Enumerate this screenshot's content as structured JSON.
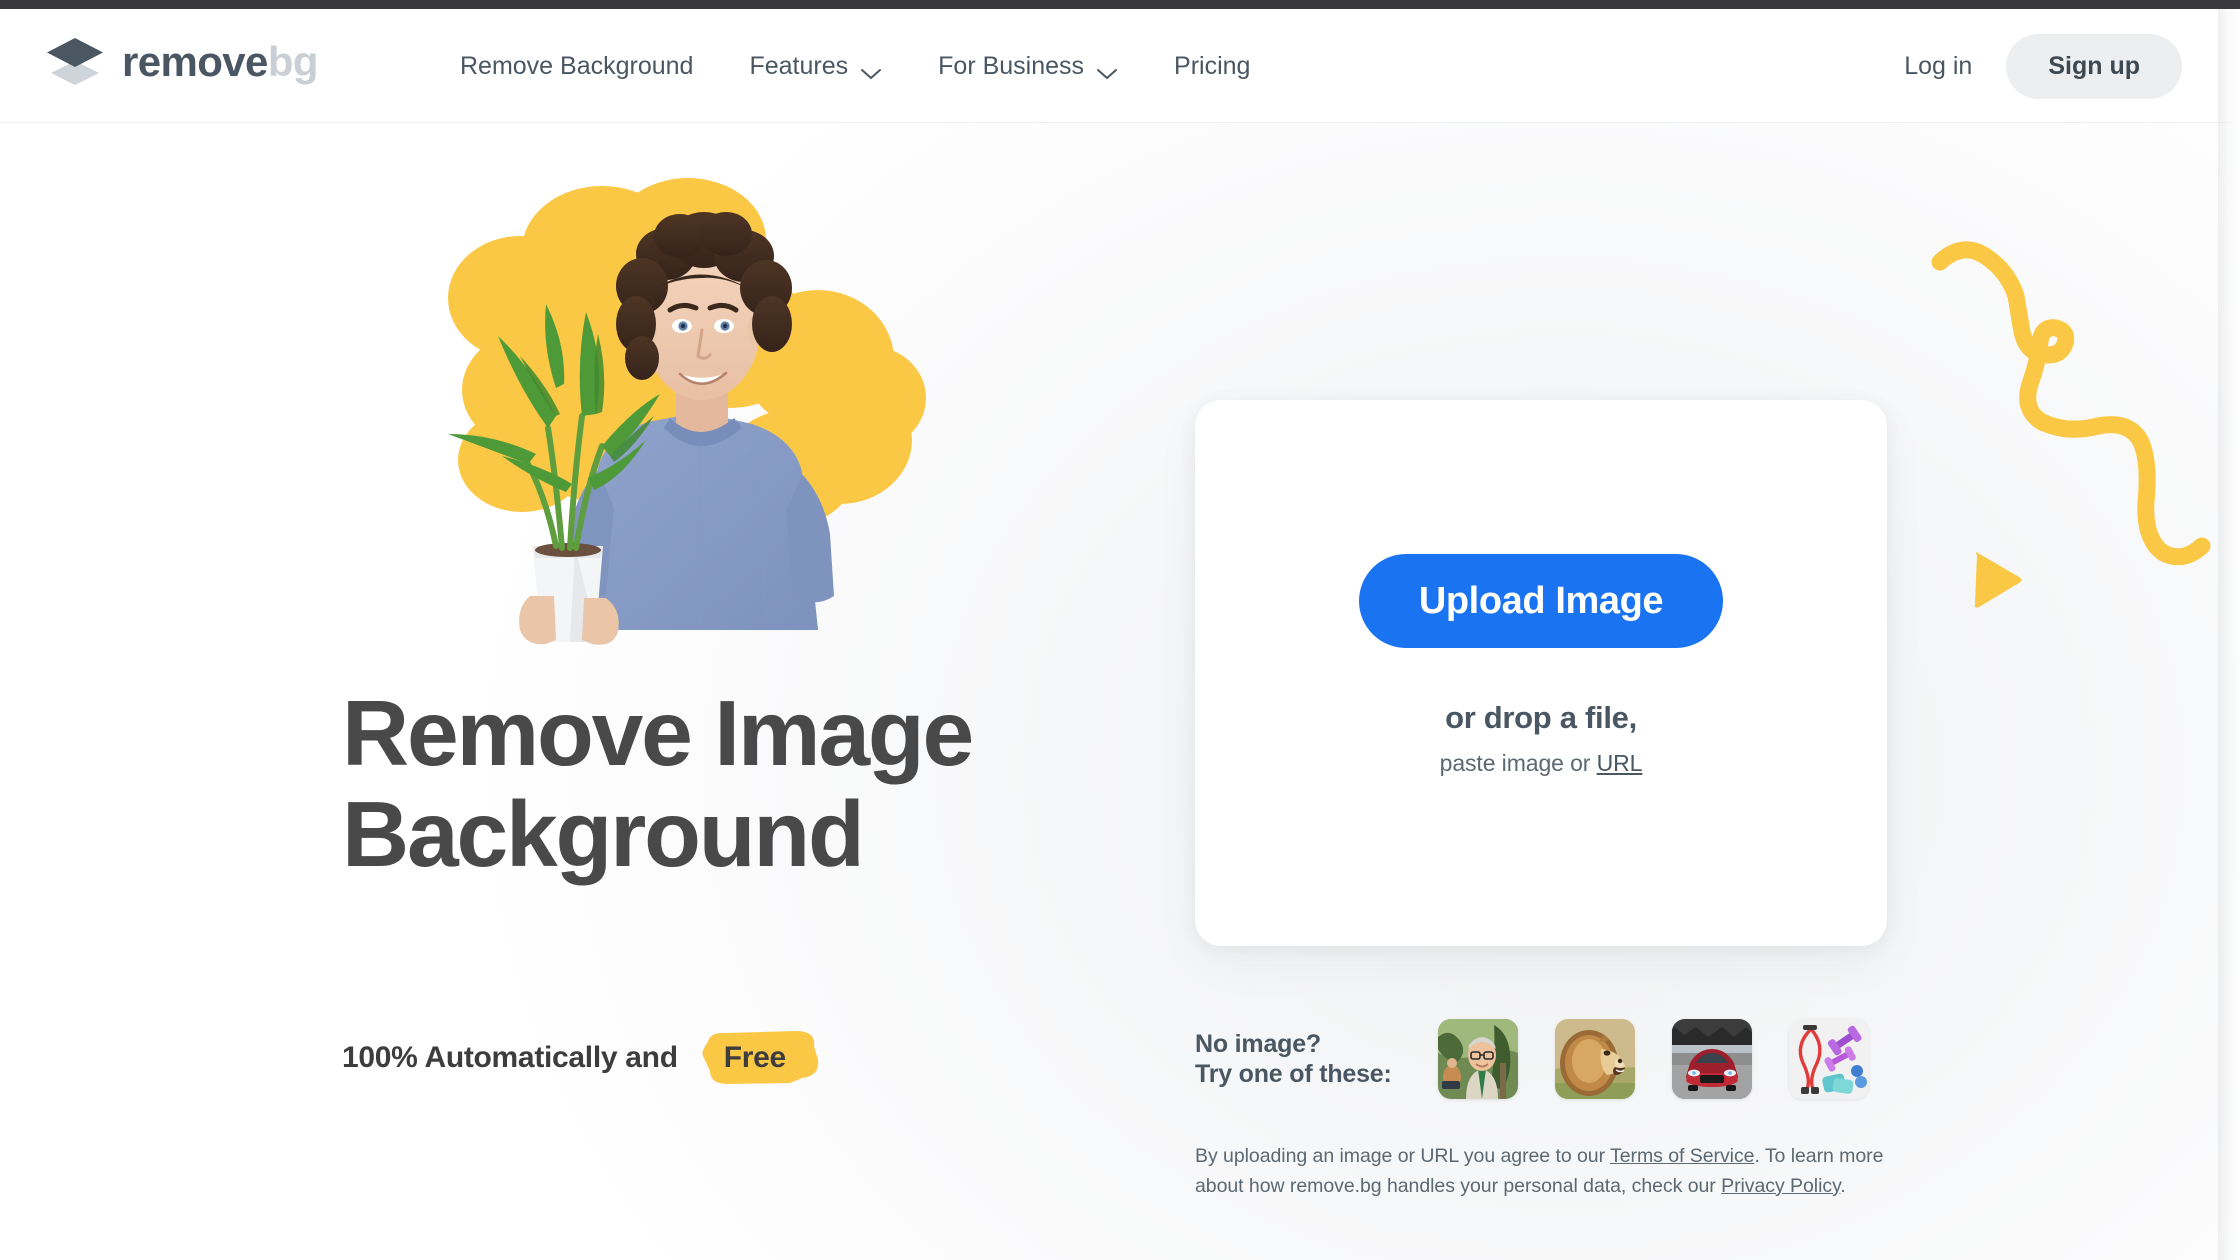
{
  "brand": {
    "logo_name_dark": "remove",
    "logo_name_light": "bg",
    "logo_icon": "stacked-diamond-icon",
    "accent_blue": "#1a73f0",
    "accent_yellow": "#FBC846",
    "logo_dark": "#4a5763",
    "logo_light": "#c9cfd4",
    "text_dark": "#494949"
  },
  "nav": {
    "items": [
      {
        "label": "Remove Background",
        "has_dropdown": false
      },
      {
        "label": "Features",
        "has_dropdown": true,
        "icon": "chevron-down-icon"
      },
      {
        "label": "For Business",
        "has_dropdown": true,
        "icon": "chevron-down-icon"
      },
      {
        "label": "Pricing",
        "has_dropdown": false
      }
    ],
    "login_label": "Log in",
    "signup_label": "Sign up"
  },
  "hero": {
    "headline_line1": "Remove Image",
    "headline_line2": "Background",
    "subline": "100% Automatically and",
    "free_label": "Free",
    "image_alt": "man-holding-plant-photo"
  },
  "upload": {
    "button_label": "Upload Image",
    "drop_text": "or drop a file,",
    "paste_prefix": "paste image or ",
    "paste_link": "URL"
  },
  "samples": {
    "label_line1": "No image?",
    "label_line2": "Try one of these:",
    "thumbnails": [
      {
        "name": "sample-thumb-man",
        "alt": "older man with glasses in greenery"
      },
      {
        "name": "sample-thumb-lion",
        "alt": "roaring lion"
      },
      {
        "name": "sample-thumb-car",
        "alt": "red sports car"
      },
      {
        "name": "sample-thumb-fitness",
        "alt": "fitness equipment flat lay"
      }
    ]
  },
  "legal": {
    "part1": "By uploading an image or URL you agree to our ",
    "terms_link": "Terms of Service",
    "part2": ". To learn more about how remove.bg handles your personal data, check our ",
    "privacy_link": "Privacy Policy",
    "part3": "."
  },
  "decorations": {
    "squiggle": "yellow-squiggle-icon",
    "triangle": "yellow-triangle-icon"
  }
}
